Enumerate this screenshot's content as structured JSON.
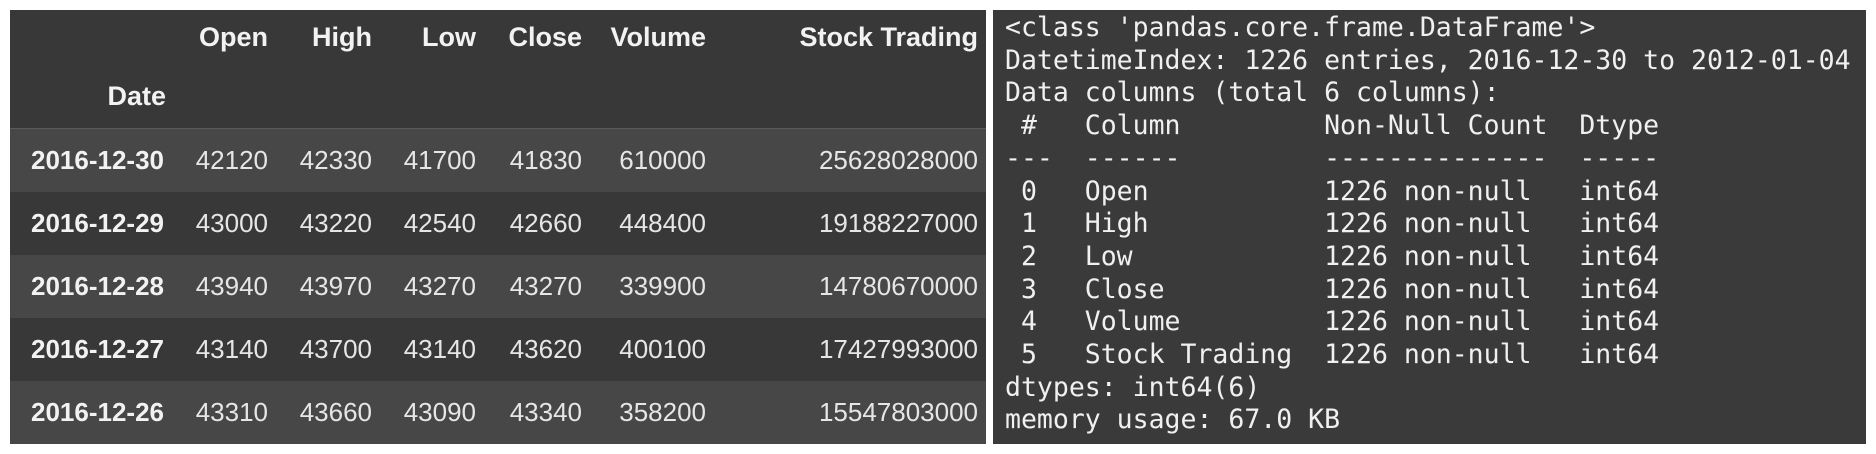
{
  "dataframe": {
    "columns": [
      "Open",
      "High",
      "Low",
      "Close",
      "Volume",
      "Stock Trading"
    ],
    "index_name": "Date",
    "rows": [
      {
        "date": "2016-12-30",
        "values": [
          "42120",
          "42330",
          "41700",
          "41830",
          "610000",
          "25628028000"
        ]
      },
      {
        "date": "2016-12-29",
        "values": [
          "43000",
          "43220",
          "42540",
          "42660",
          "448400",
          "19188227000"
        ]
      },
      {
        "date": "2016-12-28",
        "values": [
          "43940",
          "43970",
          "43270",
          "43270",
          "339900",
          "14780670000"
        ]
      },
      {
        "date": "2016-12-27",
        "values": [
          "43140",
          "43700",
          "43140",
          "43620",
          "400100",
          "17427993000"
        ]
      },
      {
        "date": "2016-12-26",
        "values": [
          "43310",
          "43660",
          "43090",
          "43340",
          "358200",
          "15547803000"
        ]
      }
    ]
  },
  "info_output": {
    "lines": [
      "<class 'pandas.core.frame.DataFrame'>",
      "DatetimeIndex: 1226 entries, 2016-12-30 to 2012-01-04",
      "Data columns (total 6 columns):",
      " #   Column         Non-Null Count  Dtype",
      "---  ------         --------------  -----",
      " 0   Open           1226 non-null   int64",
      " 1   High           1226 non-null   int64",
      " 2   Low            1226 non-null   int64",
      " 3   Close          1226 non-null   int64",
      " 4   Volume         1226 non-null   int64",
      " 5   Stock Trading  1226 non-null   int64",
      "dtypes: int64(6)",
      "memory usage: 67.0 KB"
    ]
  }
}
